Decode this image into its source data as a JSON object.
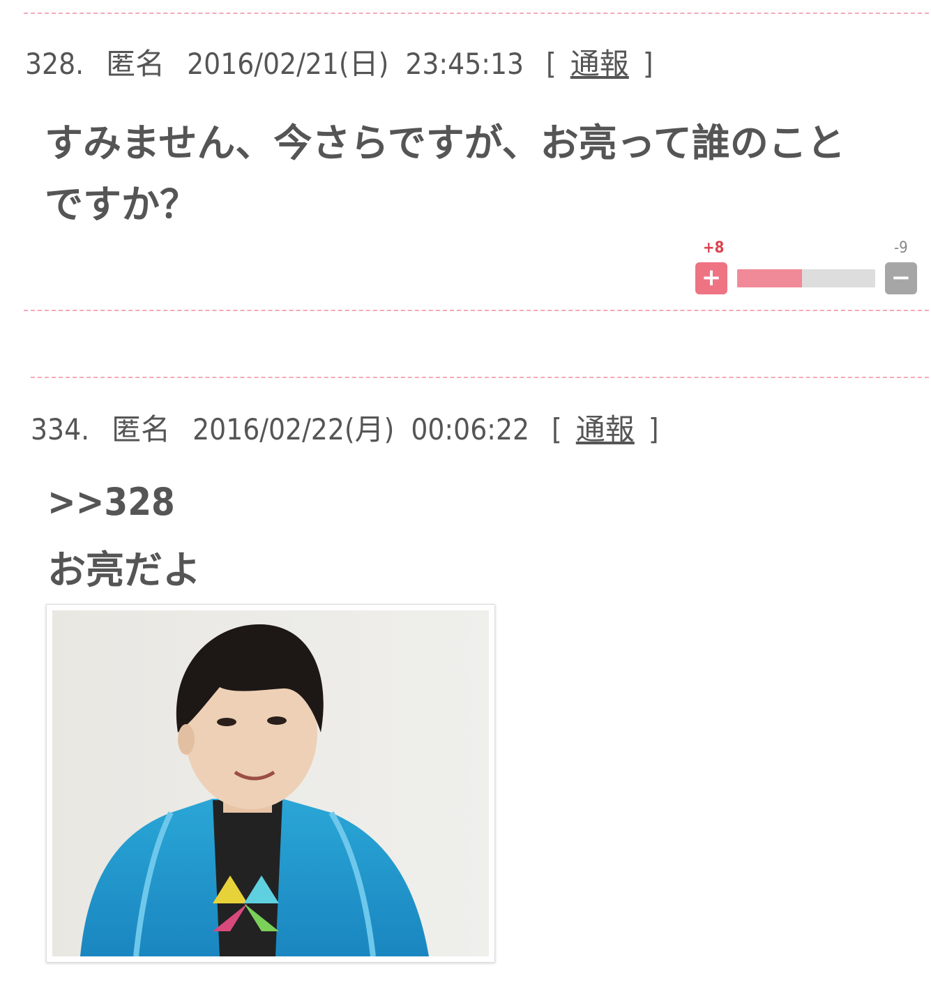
{
  "comments": [
    {
      "number": "328.",
      "author": "匿名",
      "datetime": "2016/02/21(日)  23:45:13",
      "report_open": "[",
      "report_label": "通報",
      "report_close": "]",
      "line1": "すみません、今さらですが、お亮って誰のこと",
      "line2": "ですか？",
      "votes": {
        "plus_count": "+8",
        "minus_count": "-9",
        "plus_symbol": "+",
        "minus_symbol": "−",
        "plus_fraction": 0.47
      }
    },
    {
      "number": "334.",
      "author": "匿名",
      "datetime": "2016/02/22(月)  00:06:22",
      "report_open": "[",
      "report_label": "通報",
      "report_close": "]",
      "reply_ref": ">>328",
      "body": "お亮だよ"
    }
  ],
  "colors": {
    "plus": "#ee7484",
    "plus_count": "#d9434f",
    "minus": "#a6a6a6",
    "minus_count": "#888888",
    "divider": "#f4a9b8",
    "text": "#555555"
  }
}
